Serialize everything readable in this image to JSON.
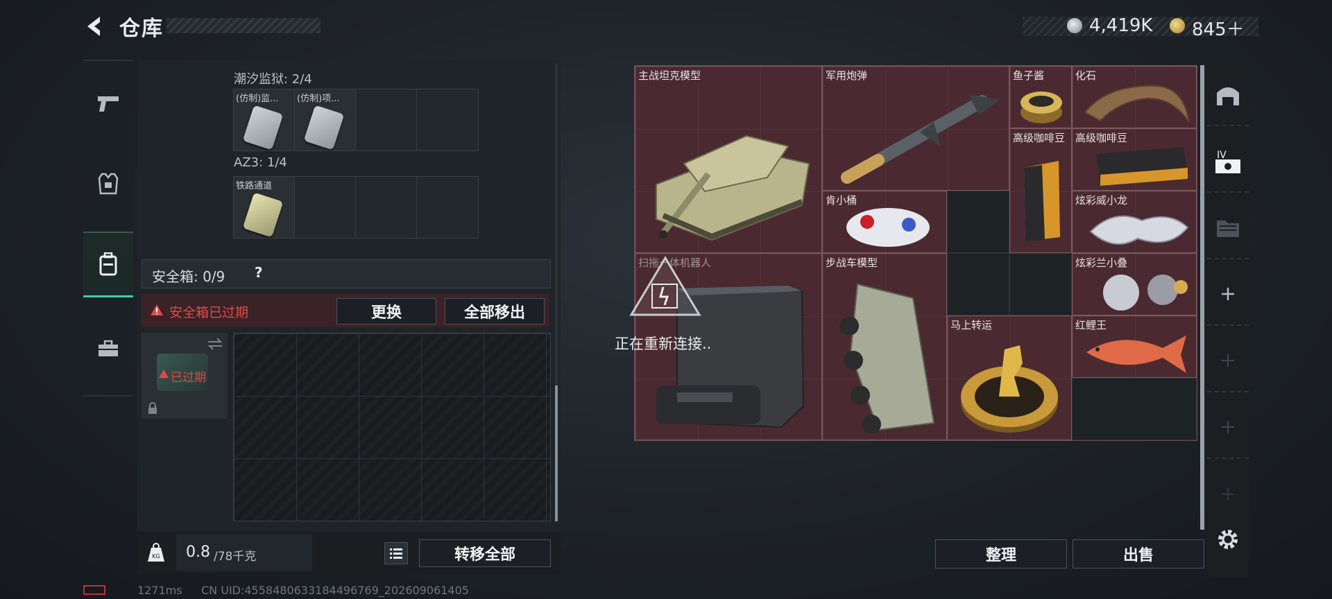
{
  "header": {
    "title": "仓库"
  },
  "currency": {
    "silver": "4,419K",
    "gold": "845＋"
  },
  "left": {
    "groups": [
      {
        "label": "潮汐监狱: 2/4",
        "slots": [
          "(仿制)监...",
          "(仿制)项..."
        ]
      },
      {
        "label": "AZ3: 1/4",
        "slots": [
          "铁路通道"
        ]
      }
    ],
    "safebox": {
      "label": "安全箱: 0/9",
      "help": "?"
    },
    "warning": {
      "text": "安全箱已过期",
      "btn_replace": "更换",
      "btn_move_all": "全部移出"
    },
    "expired_badge": "已过期",
    "weight": {
      "current": "0.8",
      "max": "/78千克",
      "icon_label": "KG"
    },
    "btn_transfer_all": "转移全部"
  },
  "right": {
    "items": [
      {
        "name": "主战坦克模型"
      },
      {
        "name": "军用炮弹"
      },
      {
        "name": "鱼子酱"
      },
      {
        "name": "化石"
      },
      {
        "name": "高级咖啡豆"
      },
      {
        "name": "高级咖啡豆"
      },
      {
        "name": "肯小桶"
      },
      {
        "name": "炫彩威小龙"
      },
      {
        "name": "扫拖一体机器人"
      },
      {
        "name": "步战车模型"
      },
      {
        "name": "炫彩兰小叠"
      },
      {
        "name": "马上转运"
      },
      {
        "name": "红鲤王"
      }
    ],
    "reconnect": "正在重新连接..",
    "btn_sort": "整理",
    "btn_sell": "出售"
  },
  "footer": {
    "ping": "1271ms",
    "uid": "CN UID:4558480633184496769_202609061405"
  },
  "colors": {
    "accent": "#49c9a8",
    "danger": "#e04a4a",
    "item_bg": "#4a2a30"
  }
}
